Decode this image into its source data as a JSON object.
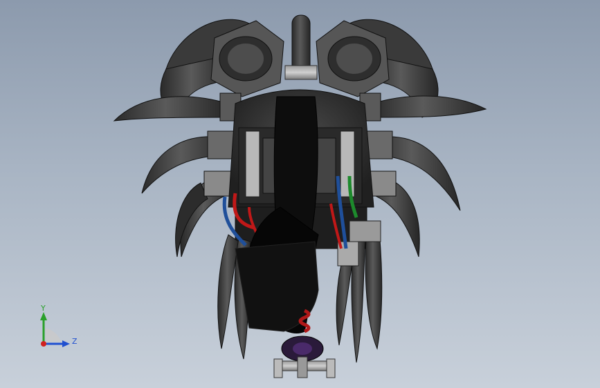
{
  "viewport": {
    "background_top": "#8c9aad",
    "background_bottom": "#c8d0da"
  },
  "model": {
    "description_icon": "cad-assembly-model",
    "tube_color": "#3c3c3c",
    "wire_colors": [
      "#1f4f9a",
      "#c01818",
      "#1d8a2c"
    ]
  },
  "triad": {
    "y_label": "Y",
    "z_label": "Z",
    "y_color": "#2aa02a",
    "z_color": "#2050d0",
    "x_color": "#d02020"
  }
}
